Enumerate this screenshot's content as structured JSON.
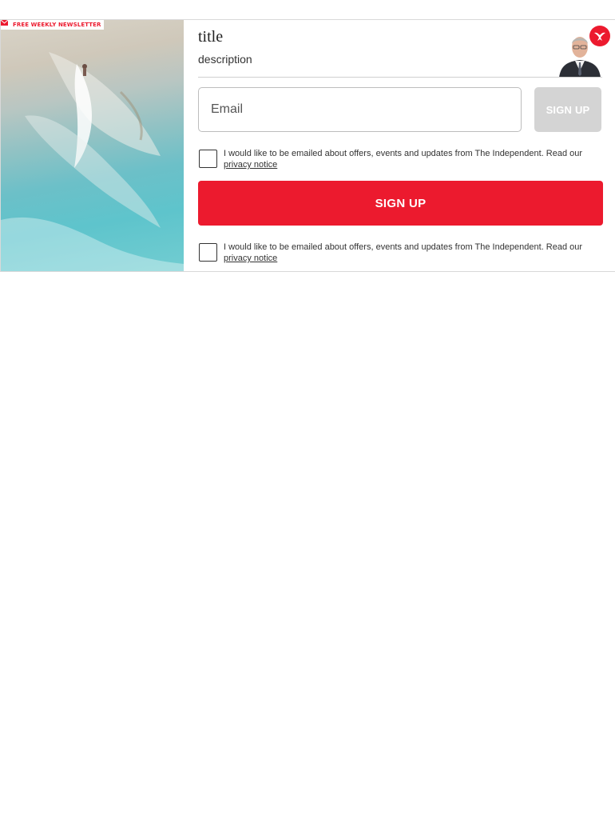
{
  "newsletter": {
    "badge_label": "FREE WEEKLY NEWSLETTER",
    "badge_icon": "mail-icon",
    "title": "title",
    "description": "description",
    "author_photo": "author-portrait",
    "brand_logo": "independent-eagle-logo",
    "email_placeholder": "Email",
    "signup_small_label": "SIGN UP",
    "signup_big_label": "SIGN UP",
    "consent": [
      {
        "text": "I would like to be emailed about offers, events and updates from The Independent. Read our ",
        "link": "privacy notice",
        "checked": false
      },
      {
        "text": "I would like to be emailed about offers, events and updates from The Independent. Read our ",
        "link": "privacy notice",
        "checked": false
      }
    ]
  },
  "colors": {
    "brand_red": "#ec1a2e",
    "disabled_button": "#d4d4d4",
    "border": "#bdbdbd",
    "text": "#333333"
  }
}
